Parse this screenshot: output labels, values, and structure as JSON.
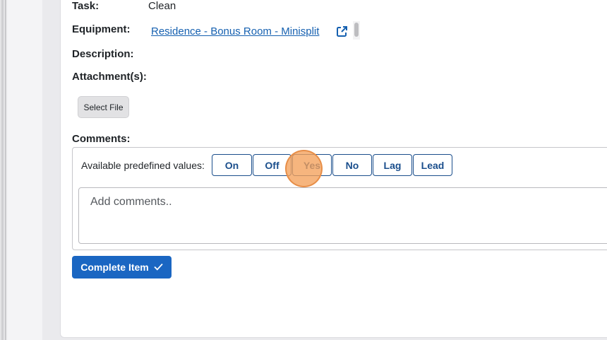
{
  "fields": {
    "task_label": "Task:",
    "task_value": "Clean",
    "equipment_label": "Equipment:",
    "equipment_link": "Residence - Bonus Room - Minisplit",
    "description_label": "Description:",
    "attachments_label": "Attachment(s):",
    "select_file_label": "Select File",
    "comments_label": "Comments:"
  },
  "predefined": {
    "label": "Available predefined values:",
    "values": [
      "On",
      "Off",
      "Yes",
      "No",
      "Lag",
      "Lead"
    ]
  },
  "comment_input": {
    "placeholder": "Add comments.."
  },
  "actions": {
    "complete_label": "Complete Item"
  },
  "icons": {
    "external_link": "external-link-icon",
    "check": "checkmark-icon"
  },
  "colors": {
    "link": "#1560b0",
    "chip_border": "#1a4e8c",
    "primary_button": "#1a66c2",
    "click_marker": "#f4a05a"
  }
}
